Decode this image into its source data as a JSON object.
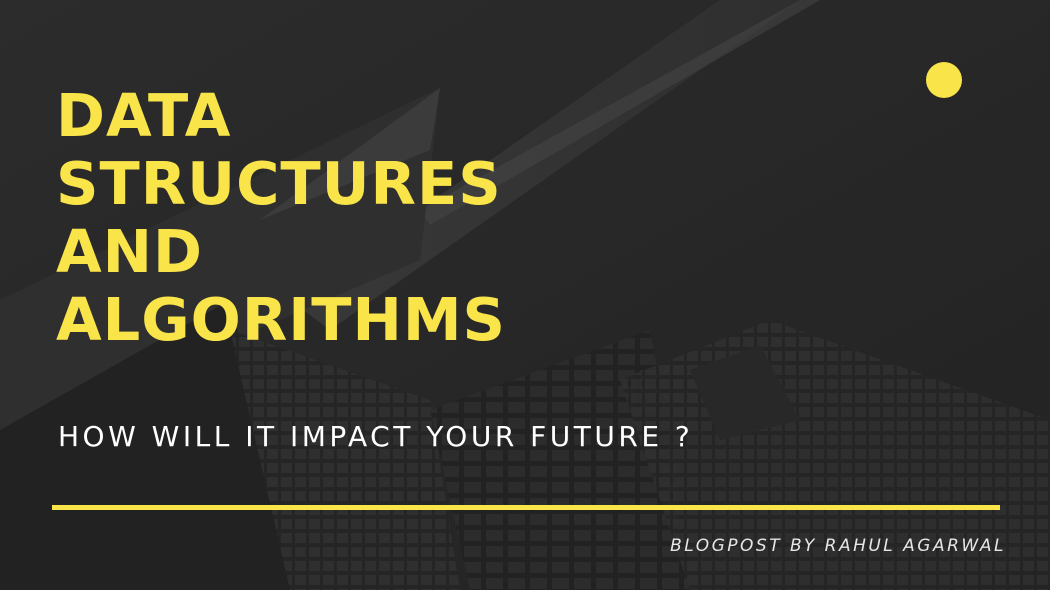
{
  "title_lines": [
    "DATA",
    "STRUCTURES",
    "AND",
    "ALGORITHMS"
  ],
  "subtitle": "HOW WILL IT IMPACT YOUR FUTURE ?",
  "byline": "BLOGPOST BY RAHUL AGARWAL",
  "colors": {
    "accent": "#f9e44a",
    "background": "#2d2d2d",
    "subtitle_text": "#ffffff",
    "byline_text": "#e6e6e6"
  },
  "background_image": "grayscale-skyscrapers-looking-up"
}
